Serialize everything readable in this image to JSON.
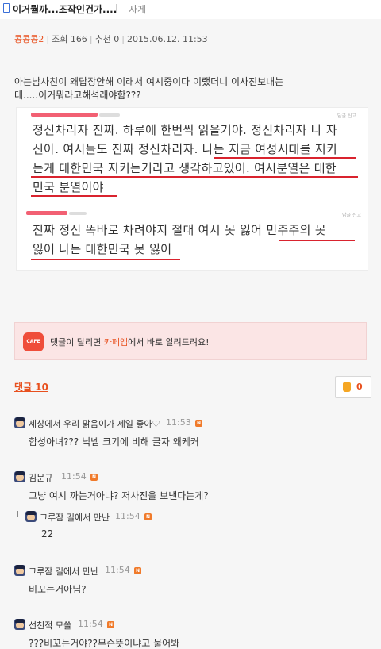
{
  "header": {
    "title": "이거뭘까...조작인건가....",
    "board": "자게"
  },
  "post": {
    "author": "콩콩콩2",
    "views": "조회 166",
    "recommends": "추천 0",
    "datetime": "2015.06.12. 11:53",
    "body_lines": [
      "아는남사친이 왜답장안해 이래서 여시중이다 이랬더니 이사진보내는",
      "데.....이거뭐라고해석래야함???"
    ]
  },
  "capture": {
    "block1_lines": [
      "정신차리자 진짜. 하루에 한번씩 읽을거야. 정신차리자 나 자",
      "신아. 여시들도 진짜 정신차리자. 나는 지금 여성시대를 지키",
      "는게 대한민국 지키는거라고 생각하고있어. 여시분열은 대한",
      "민국 분열이야"
    ],
    "block2_lines": [
      "진짜 정신 똑바로 차려야지 절대 여시 못 잃어 민주주의 못",
      "잃어 나는 대한민국 못 잃어"
    ],
    "tiny_label_1": "답글 신고",
    "tiny_label_2": "답글 신고"
  },
  "notify": {
    "icon_text": "CAFE",
    "text_before": "댓글이 달리면 ",
    "text_highlight": "카페앱",
    "text_after": "에서 바로 알려드려요!"
  },
  "comments_header": {
    "count_label": "댓글 10",
    "like_count": "0"
  },
  "comments": [
    {
      "nick": "세상에서 우리 맑음이가 제일 좋아♡",
      "time": "11:53",
      "text": "합성아녀??? 닉넴 크기에 비해 글자 왜케커",
      "reply": false
    },
    {
      "nick": "김문규",
      "time": "11:54",
      "text": "그냥 여시 까는거아냐? 저사진을 보낸다는게?",
      "reply": false
    },
    {
      "nick": "그루잠 길에서 만난",
      "time": "11:54",
      "text": "22",
      "reply": true
    },
    {
      "nick": "그루잠 길에서 만난",
      "time": "11:54",
      "text": "비꼬는거아님?",
      "reply": false
    },
    {
      "nick": "선천적 모쏠",
      "time": "11:54",
      "text": "???비꼬는거야??무슨뜻이냐고 물어봐",
      "reply": false
    }
  ],
  "badge_text": "N",
  "colors": {
    "accent": "#e8501e",
    "underline": "#d9232e",
    "notify_bg": "#fbe5e5"
  }
}
